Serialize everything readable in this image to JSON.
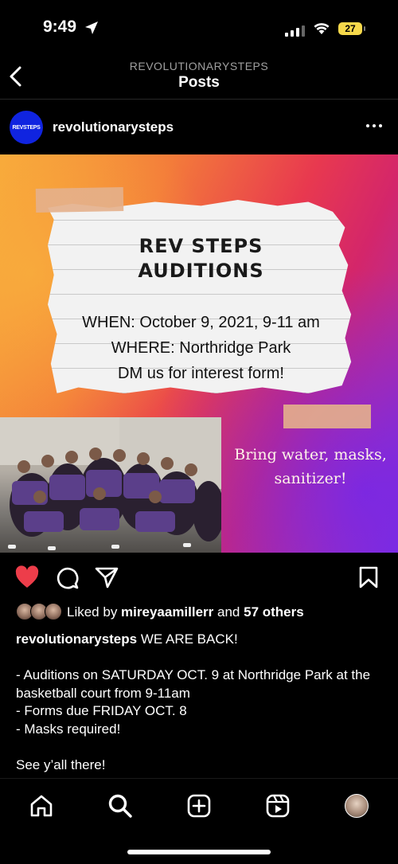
{
  "status_bar": {
    "time": "9:49",
    "battery": "27"
  },
  "header": {
    "subtitle": "REVOLUTIONARYSTEPS",
    "title": "Posts"
  },
  "post": {
    "username": "revolutionarysteps",
    "avatar_text": "REVSTEPS",
    "image": {
      "title_line1": "REV STEPS",
      "title_line2": "AUDITIONS",
      "when": "WHEN: October 9, 2021, 9-11 am",
      "where": "WHERE: Northridge Park",
      "dm": "DM us for interest form!",
      "bring_line1": "Bring water, masks,",
      "bring_line2": "sanitizer!"
    },
    "liked_by_prefix": "Liked by ",
    "liked_by_user": "mireyaamillerr",
    "liked_by_mid": " and ",
    "liked_by_others": "57 others",
    "caption": {
      "username": "revolutionarysteps",
      "first": " WE ARE BACK!",
      "lines": [
        "- Auditions on SATURDAY OCT. 9 at Northridge Park at the basketball court from 9-11am",
        "- Forms due FRIDAY OCT. 8",
        "- Masks required!"
      ],
      "closing": "See y’all there!"
    }
  },
  "icons": {
    "heart": "heart-icon-liked",
    "comment": "comment-icon",
    "share": "share-icon",
    "save": "bookmark-icon"
  },
  "colors": {
    "like_red": "#ed3d4a",
    "avatar_blue": "#1024e0",
    "battery_yellow": "#f7d94b"
  }
}
